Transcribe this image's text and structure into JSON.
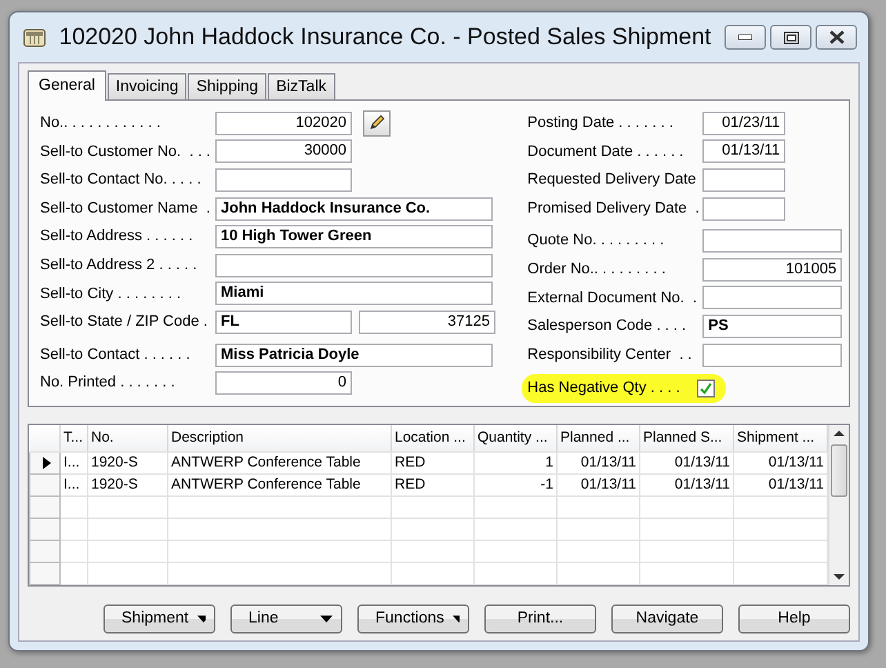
{
  "window": {
    "title": "102020 John Haddock Insurance Co. - Posted Sales Shipment"
  },
  "tabs": [
    {
      "label": "General",
      "selected": true
    },
    {
      "label": "Invoicing",
      "selected": false
    },
    {
      "label": "Shipping",
      "selected": false
    },
    {
      "label": "BizTalk",
      "selected": false
    }
  ],
  "general": {
    "left_fields": [
      {
        "label": "No.. . . . . . . . . . . .",
        "kind": "number_edit",
        "value": "102020"
      },
      {
        "label": "Sell-to Customer No.  . . .",
        "kind": "number",
        "value": "30000"
      },
      {
        "label": "Sell-to Contact No. . . . .",
        "kind": "short"
      },
      {
        "label": "Sell-to Customer Name  .",
        "kind": "text",
        "value": "John Haddock Insurance Co."
      },
      {
        "label": "Sell-to Address . . . . . .",
        "kind": "text",
        "value": "10 High Tower Green"
      },
      {
        "label": "Sell-to Address 2 . . . . .",
        "kind": "text"
      },
      {
        "label": "Sell-to City . . . . . . . .",
        "kind": "text",
        "value": "Miami"
      },
      {
        "label": "Sell-to State / ZIP Code .",
        "kind": "pair",
        "values": [
          "FL",
          "37125"
        ]
      },
      {
        "label": "Sell-to Contact . . . . . .",
        "kind": "text",
        "value": "Miss Patricia Doyle"
      },
      {
        "label": "No. Printed . . . . . . .",
        "kind": "number",
        "value": "0"
      }
    ],
    "right_fields": [
      {
        "label": "Posting Date . . . . . . .",
        "kind": "date",
        "value": "01/23/11"
      },
      {
        "label": "Document Date . . . . . .",
        "kind": "date",
        "value": "01/13/11"
      },
      {
        "label": "Requested Delivery Date",
        "kind": "date"
      },
      {
        "label": "Promised Delivery Date  .",
        "kind": "date"
      },
      {
        "label": "Quote No. . . . . . . . .",
        "kind": "text"
      },
      {
        "label": "Order No.. . . . . . . . .",
        "kind": "textnum",
        "value": "101005"
      },
      {
        "label": "External Document No.  .",
        "kind": "text"
      },
      {
        "label": "Salesperson Code . . . .",
        "kind": "text",
        "value": "PS"
      },
      {
        "label": "Responsibility Center  . .",
        "kind": "text"
      },
      {
        "label": "Has Negative Qty . . . .",
        "kind": "checkbox",
        "checked": true,
        "highlighted": true
      }
    ]
  },
  "lines": {
    "columns": [
      "T...",
      "No.",
      "Description",
      "Location ...",
      "Quantity ...",
      "Planned ...",
      "Planned S...",
      "Shipment ..."
    ],
    "rows": [
      {
        "current": true,
        "cells": [
          "I...",
          "1920-S",
          "ANTWERP Conference Table",
          "RED",
          "1",
          "01/13/11",
          "01/13/11",
          "01/13/11"
        ]
      },
      {
        "current": false,
        "cells": [
          "I...",
          "1920-S",
          "ANTWERP Conference Table",
          "RED",
          "-1",
          "01/13/11",
          "01/13/11",
          "01/13/11"
        ]
      }
    ]
  },
  "buttons": [
    {
      "label": "Shipment",
      "dropdown": true
    },
    {
      "label": "Line",
      "dropdown": true
    },
    {
      "label": "Functions",
      "dropdown": true
    },
    {
      "label": "Print...",
      "dropdown": false
    },
    {
      "label": "Navigate",
      "dropdown": false
    },
    {
      "label": "Help",
      "dropdown": false
    }
  ]
}
